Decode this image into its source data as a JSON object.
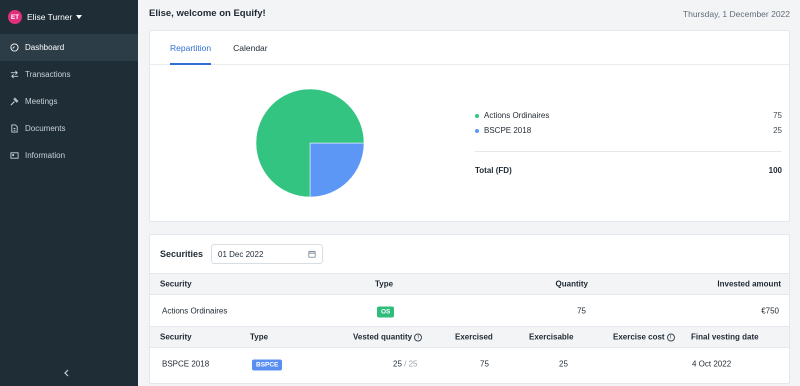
{
  "user": {
    "initials": "ET",
    "name": "Elise Turner"
  },
  "nav": [
    {
      "label": "Dashboard",
      "icon": "dashboard-icon",
      "active": true
    },
    {
      "label": "Transactions",
      "icon": "transfer-icon"
    },
    {
      "label": "Meetings",
      "icon": "gavel-icon"
    },
    {
      "label": "Documents",
      "icon": "document-icon"
    },
    {
      "label": "Information",
      "icon": "id-card-icon"
    }
  ],
  "header": {
    "welcome": "Elise, welcome on Equify!",
    "date": "Thursday, 1 December 2022"
  },
  "tabs": [
    {
      "label": "Repartition",
      "active": true
    },
    {
      "label": "Calendar"
    }
  ],
  "legend": {
    "items": [
      {
        "label": "Actions Ordinaires",
        "value": "75",
        "color": "#33c481"
      },
      {
        "label": "BSCPE 2018",
        "value": "25",
        "color": "#5c97f5"
      }
    ],
    "total_label": "Total (FD)",
    "total_value": "100"
  },
  "chart_data": {
    "type": "pie",
    "categories": [
      "Actions Ordinaires",
      "BSCPE 2018"
    ],
    "values": [
      75,
      25
    ],
    "colors": [
      "#33c481",
      "#5c97f5"
    ]
  },
  "securities": {
    "title": "Securities",
    "date_value": "01 Dec 2022",
    "head1": {
      "security": "Security",
      "type": "Type",
      "quantity": "Quantity",
      "invested": "Invested amount"
    },
    "row1": {
      "security": "Actions Ordinaires",
      "type": "OS",
      "quantity": "75",
      "invested": "€750"
    },
    "head2": {
      "security": "Security",
      "type": "Type",
      "vested": "Vested quantity",
      "exercised": "Exercised",
      "exercisable": "Exercisable",
      "cost": "Exercise cost",
      "final": "Final vesting date"
    },
    "row2": {
      "security": "BSPCE 2018",
      "type": "BSPCE",
      "vested": "25",
      "vested_total": "/ 25",
      "exercised": "75",
      "exercisable": "25",
      "final": "4 Oct 2022"
    }
  }
}
